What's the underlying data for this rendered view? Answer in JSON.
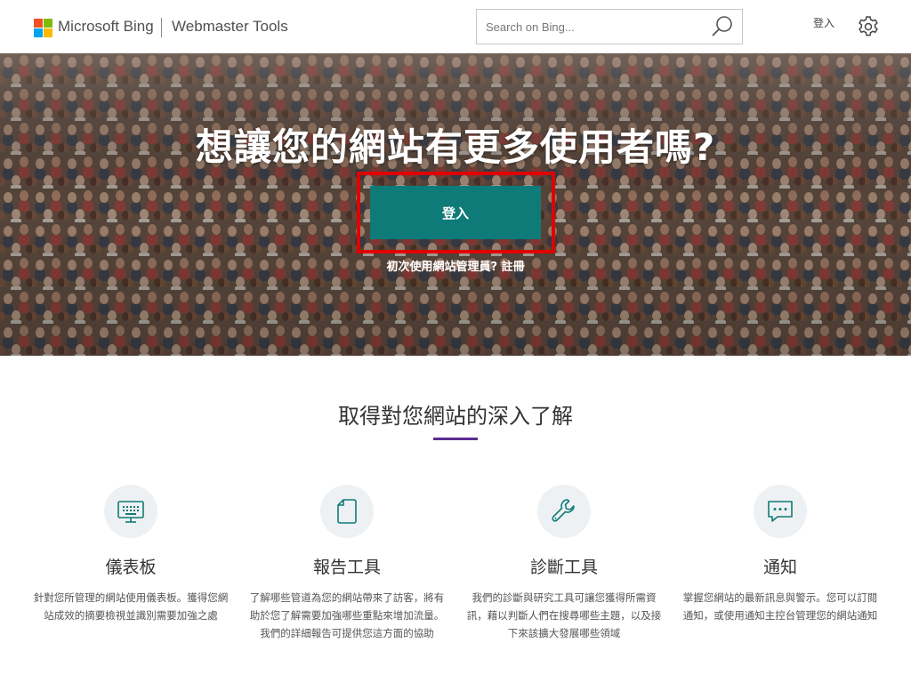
{
  "header": {
    "brand": "Microsoft Bing",
    "product": "Webmaster Tools",
    "search_placeholder": "Search on Bing...",
    "login": "登入"
  },
  "hero": {
    "title": "想讓您的網站有更多使用者嗎?",
    "signin_button": "登入",
    "register_prompt": "初次使用網站管理員?",
    "register_link": "註冊"
  },
  "section": {
    "title": "取得對您網站的深入了解"
  },
  "features": [
    {
      "icon": "dashboard-monitor-icon",
      "title": "儀表板",
      "description": "針對您所管理的網站使用儀表板。獲得您網站成效的摘要檢視並識別需要加強之處"
    },
    {
      "icon": "report-document-icon",
      "title": "報告工具",
      "description": "了解哪些管道為您的網站帶來了訪客，將有助於您了解需要加強哪些重點來增加流量。我們的詳細報告可提供您這方面的協助"
    },
    {
      "icon": "wrench-icon",
      "title": "診斷工具",
      "description": "我們的診斷與研究工具可讓您獲得所需資訊，藉以判斷人們在搜尋哪些主題，以及接下來該擴大發展哪些領域"
    },
    {
      "icon": "chat-bubble-icon",
      "title": "通知",
      "description": "掌握您網站的最新訊息與警示。您可以訂閱通知，或使用通知主控台管理您的網站通知"
    }
  ],
  "colors": {
    "accent_teal": "#0f7b78",
    "accent_purple": "#5c2d91",
    "highlight_red": "#e00000"
  }
}
